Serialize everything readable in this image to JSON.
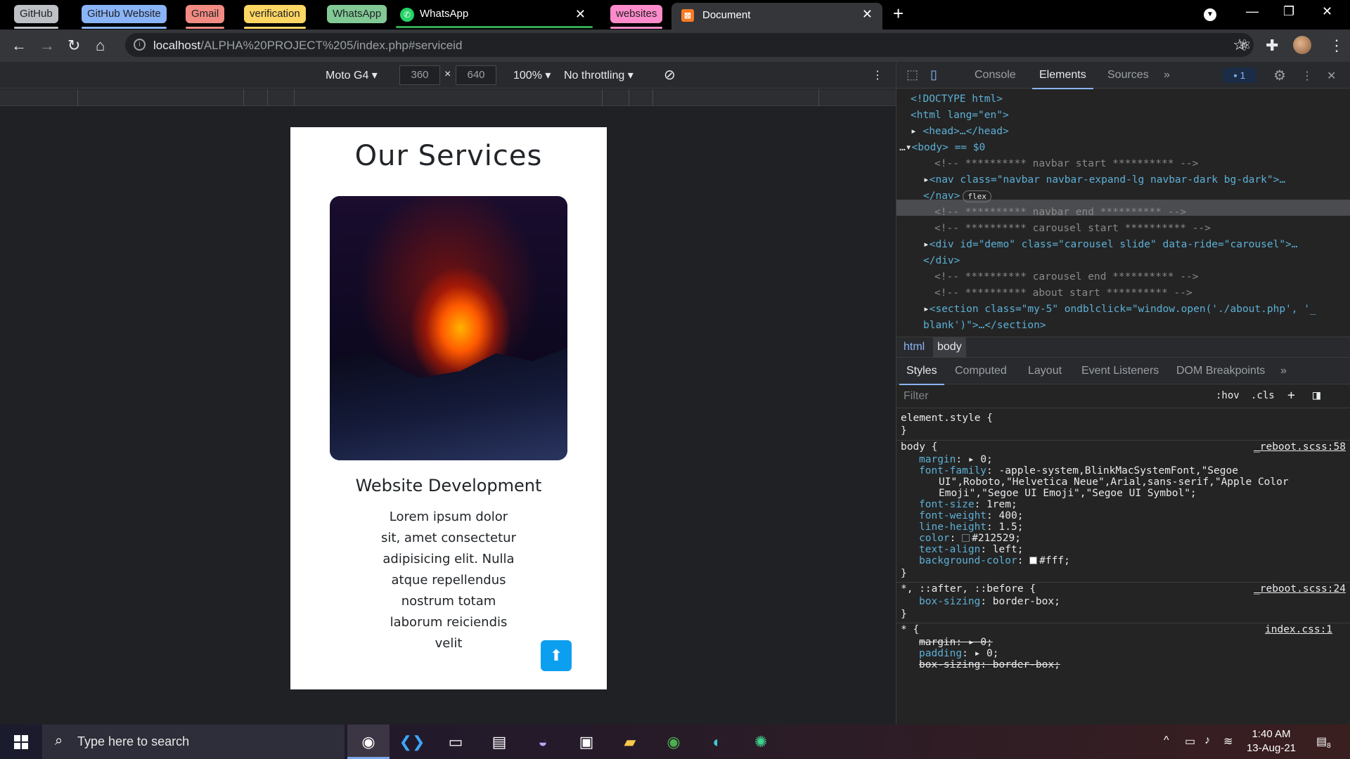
{
  "tabstrip": {
    "groups": [
      {
        "label": "GitHub",
        "color": "#bdc1c6"
      },
      {
        "label": "GitHub Website",
        "color": "#8ab4f8"
      },
      {
        "label": "Gmail",
        "color": "#f28b82"
      },
      {
        "label": "verification",
        "color": "#fdd663"
      },
      {
        "label": "WhatsApp",
        "color": "#81c995"
      },
      {
        "label": "websites",
        "color": "#ff8bcb"
      }
    ],
    "whatsapp_tab": "WhatsApp",
    "active_tab": "Document"
  },
  "omnibox": {
    "host": "localhost",
    "path": "/ALPHA%20PROJECT%205/index.php#serviceid"
  },
  "device_toolbar": {
    "device": "Moto G4",
    "width": "360",
    "times": "×",
    "height": "640",
    "zoom": "100%",
    "throttling": "No throttling"
  },
  "page": {
    "title": "Our Services",
    "card_title": "Website Development",
    "card_text": "Lorem ipsum dolor sit, amet consectetur adipisicing elit. Nulla atque repellendus nostrum totam laborum reiciendis velit"
  },
  "devtools": {
    "tabs": [
      "Console",
      "Elements",
      "Sources"
    ],
    "active_tab": "Elements",
    "issues_count": "1",
    "dom_lines": [
      "<!DOCTYPE html>",
      "<html lang=\"en\">",
      "<head>…</head>",
      "<body> == $0",
      "<!-- ********** navbar start ********** -->",
      "<nav class=\"navbar navbar-expand-lg navbar-dark bg-dark\">…",
      "</nav>",
      "<!-- ********** navbar end ********** -->",
      "<!-- ********** carousel start ********** -->",
      "<div id=\"demo\" class=\"carousel slide\" data-ride=\"carousel\">…",
      "</div>",
      "<!-- ********** carousel end ********** -->",
      "<!-- ********** about start ********** -->",
      "<section class=\"my-5\" ondblclick=\"window.open('./about.php', '_",
      "blank')\">…</section>"
    ],
    "flex_chip": "flex",
    "breadcrumbs": [
      "html",
      "body"
    ],
    "styles_tabs": [
      "Styles",
      "Computed",
      "Layout",
      "Event Listeners",
      "DOM Breakpoints"
    ],
    "filter_placeholder": "Filter",
    "filter_hov": ":hov",
    "filter_cls": ".cls",
    "rules": {
      "element_style": "element.style {",
      "close": "}",
      "body_selector": "body {",
      "body_source": "_reboot.scss:58",
      "body_props": [
        {
          "name": "margin",
          "value": "0;"
        },
        {
          "name": "font-family",
          "value": "-apple-system,BlinkMacSystemFont,\"Segoe"
        },
        {
          "name": "",
          "value": "UI\",Roboto,\"Helvetica Neue\",Arial,sans-serif,\"Apple Color"
        },
        {
          "name": "",
          "value": "Emoji\",\"Segoe UI Emoji\",\"Segoe UI Symbol\";"
        },
        {
          "name": "font-size",
          "value": "1rem;"
        },
        {
          "name": "font-weight",
          "value": "400;"
        },
        {
          "name": "line-height",
          "value": "1.5;"
        },
        {
          "name": "color",
          "value": "#212529;"
        },
        {
          "name": "text-align",
          "value": "left;"
        },
        {
          "name": "background-color",
          "value": "#fff;"
        }
      ],
      "universal_selector": "*, ::after, ::before {",
      "universal_source": "_reboot.scss:24",
      "universal_prop": {
        "name": "box-sizing",
        "value": "border-box;"
      },
      "star_selector": "* {",
      "star_source": "index.css:1",
      "star_props": [
        {
          "name": "margin",
          "value": "0;"
        },
        {
          "name": "padding",
          "value": "0;"
        },
        {
          "name": "box-sizing",
          "value": "border-box;"
        }
      ]
    }
  },
  "taskbar": {
    "search_placeholder": "Type here to search",
    "time": "1:40 AM",
    "date": "13-Aug-21",
    "notifications": "8"
  }
}
